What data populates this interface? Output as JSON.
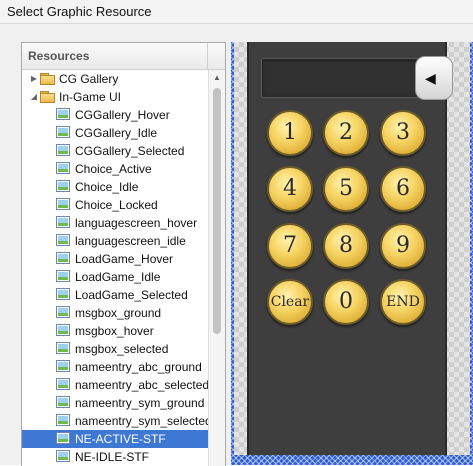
{
  "window": {
    "title": "Select Graphic Resource"
  },
  "resources": {
    "header": "Resources",
    "tree": [
      {
        "label": "CG Gallery",
        "type": "folder",
        "expander": "▶",
        "level": 0
      },
      {
        "label": "In-Game UI",
        "type": "folder",
        "expander": "◢",
        "level": 0
      },
      {
        "label": "CGGallery_Hover",
        "type": "image",
        "level": 1
      },
      {
        "label": "CGGallery_Idle",
        "type": "image",
        "level": 1
      },
      {
        "label": "CGGallery_Selected",
        "type": "image",
        "level": 1
      },
      {
        "label": "Choice_Active",
        "type": "image",
        "level": 1
      },
      {
        "label": "Choice_Idle",
        "type": "image",
        "level": 1
      },
      {
        "label": "Choice_Locked",
        "type": "image",
        "level": 1
      },
      {
        "label": "languagescreen_hover",
        "type": "image",
        "level": 1
      },
      {
        "label": "languagescreen_idle",
        "type": "image",
        "level": 1
      },
      {
        "label": "LoadGame_Hover",
        "type": "image",
        "level": 1
      },
      {
        "label": "LoadGame_Idle",
        "type": "image",
        "level": 1
      },
      {
        "label": "LoadGame_Selected",
        "type": "image",
        "level": 1
      },
      {
        "label": "msgbox_ground",
        "type": "image",
        "level": 1
      },
      {
        "label": "msgbox_hover",
        "type": "image",
        "level": 1
      },
      {
        "label": "msgbox_selected",
        "type": "image",
        "level": 1
      },
      {
        "label": "nameentry_abc_ground",
        "type": "image",
        "level": 1
      },
      {
        "label": "nameentry_abc_selected",
        "type": "image",
        "level": 1
      },
      {
        "label": "nameentry_sym_ground",
        "type": "image",
        "level": 1
      },
      {
        "label": "nameentry_sym_selected",
        "type": "image",
        "level": 1
      },
      {
        "label": "NE-ACTIVE-STF",
        "type": "image",
        "level": 1,
        "selected": true
      },
      {
        "label": "NE-IDLE-STF",
        "type": "image",
        "level": 1
      }
    ]
  },
  "preview": {
    "backspace_icon": "◀",
    "keys": [
      "1",
      "2",
      "3",
      "4",
      "5",
      "6",
      "7",
      "8",
      "9",
      "Clear",
      "0",
      "END"
    ],
    "colors": {
      "selection": "#3e78d2",
      "key_gold": "#f2cd5c",
      "keypad_bg": "#3e3e3e"
    }
  }
}
